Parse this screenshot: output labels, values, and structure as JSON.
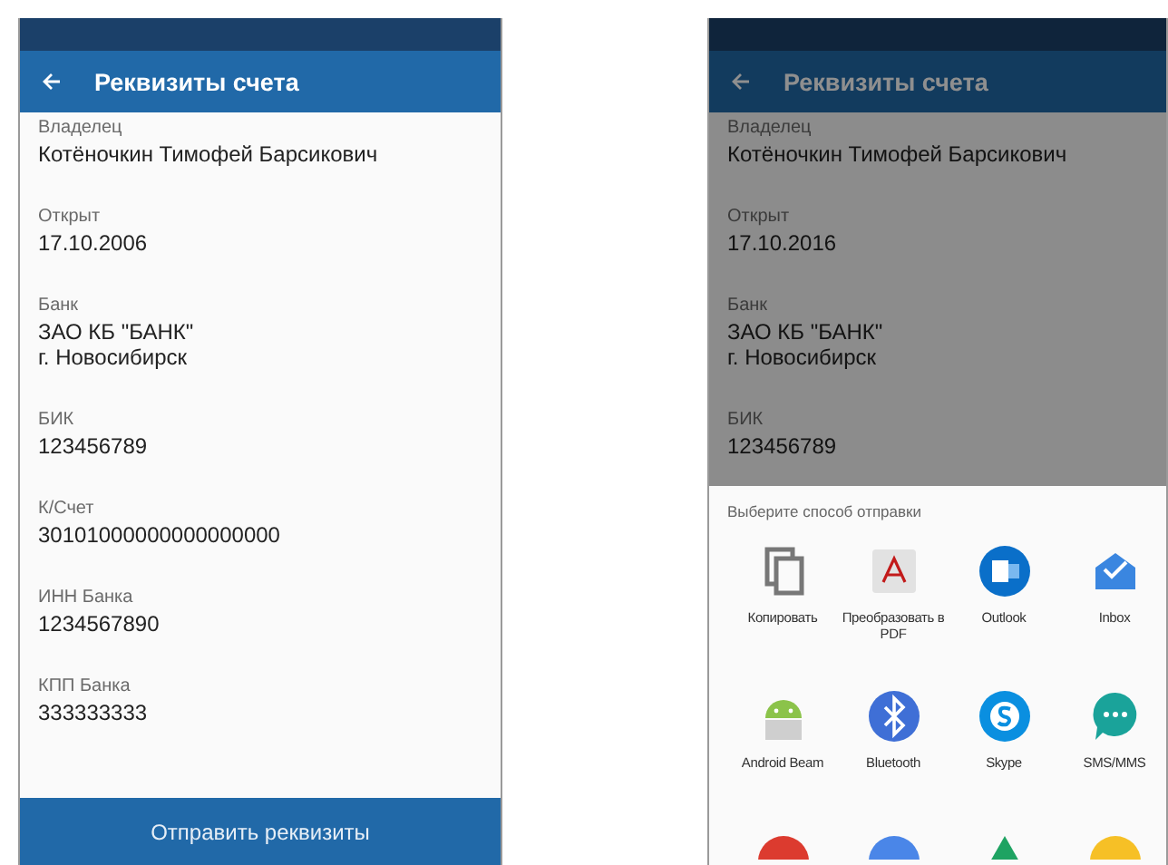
{
  "screens": [
    {
      "kind": "details",
      "dimmed": false,
      "title": "Реквизиты счета",
      "fields": [
        {
          "label": "Владелец",
          "value": "Котёночкин Тимофей Барсикович"
        },
        {
          "label": "Открыт",
          "value": "17.10.2006"
        },
        {
          "label": "Банк",
          "value": "ЗАО КБ \"БАНК\"\nг. Новосибирск"
        },
        {
          "label": "БИК",
          "value": "123456789"
        },
        {
          "label": "К/Счет",
          "value": "30101000000000000000"
        },
        {
          "label": "ИНН Банка",
          "value": "1234567890"
        },
        {
          "label": "КПП Банка",
          "value": "333333333"
        }
      ],
      "button": "Отправить реквизиты"
    },
    {
      "kind": "share",
      "dimmed": true,
      "title": "Реквизиты счета",
      "fields": [
        {
          "label": "Владелец",
          "value": "Котёночкин Тимофей Барсикович"
        },
        {
          "label": "Открыт",
          "value": "17.10.2016"
        },
        {
          "label": "Банк",
          "value": "ЗАО КБ \"БАНК\"\nг. Новосибирск"
        },
        {
          "label": "БИК",
          "value": "123456789"
        }
      ],
      "share_sheet": {
        "title": "Выберите способ отправки",
        "apps": [
          {
            "kind": "copy",
            "label": "Копировать"
          },
          {
            "kind": "pdf",
            "label": "Преобразовать в PDF"
          },
          {
            "kind": "outlook",
            "label": "Outlook"
          },
          {
            "kind": "inbox",
            "label": "Inbox"
          },
          {
            "kind": "android",
            "label": "Android Beam"
          },
          {
            "kind": "bluetooth",
            "label": "Bluetooth"
          },
          {
            "kind": "skype",
            "label": "Skype"
          },
          {
            "kind": "sms",
            "label": "SMS/MMS"
          },
          {
            "kind": "red"
          },
          {
            "kind": "blue"
          },
          {
            "kind": "drive"
          },
          {
            "kind": "yellow"
          }
        ]
      }
    }
  ]
}
